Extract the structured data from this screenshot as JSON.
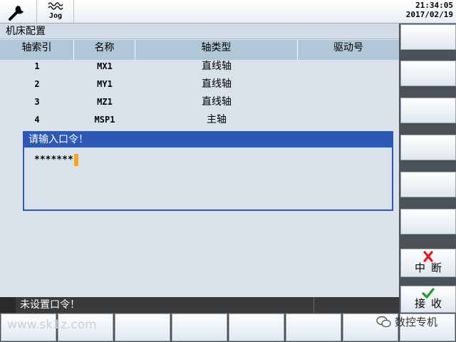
{
  "topbar": {
    "jog_label": "Jog",
    "time": "21:34:05",
    "date": "2017/02/19",
    "icons": [
      "wrench-icon",
      "jog-wave-icon"
    ]
  },
  "window_title": "机床配置",
  "table": {
    "columns": [
      "轴索引",
      "名称",
      "轴类型",
      "驱动号"
    ],
    "rows": [
      {
        "index": "1",
        "name": "MX1",
        "type": "直线轴",
        "drive": ""
      },
      {
        "index": "2",
        "name": "MY1",
        "type": "直线轴",
        "drive": ""
      },
      {
        "index": "3",
        "name": "MZ1",
        "type": "直线轴",
        "drive": ""
      },
      {
        "index": "4",
        "name": "MSP1",
        "type": "主轴",
        "drive": ""
      }
    ]
  },
  "dialog": {
    "title": "请输入口令！",
    "password_value": "*******"
  },
  "status": {
    "message": "未设置口令！"
  },
  "softkeys": {
    "cancel_label": "中断",
    "accept_label": "接收",
    "cancel_icon": "x-icon",
    "accept_icon": "checkmark-icon",
    "cancel_color": "#e8141c",
    "accept_color": "#1f9a2e"
  },
  "watermark": {
    "left": "www.sk1z.com",
    "right": "数控专机"
  },
  "colors": {
    "dialog_blue": "#2d58b5",
    "header_blue": "#b0c7d8",
    "cursor": "#f5a623"
  }
}
